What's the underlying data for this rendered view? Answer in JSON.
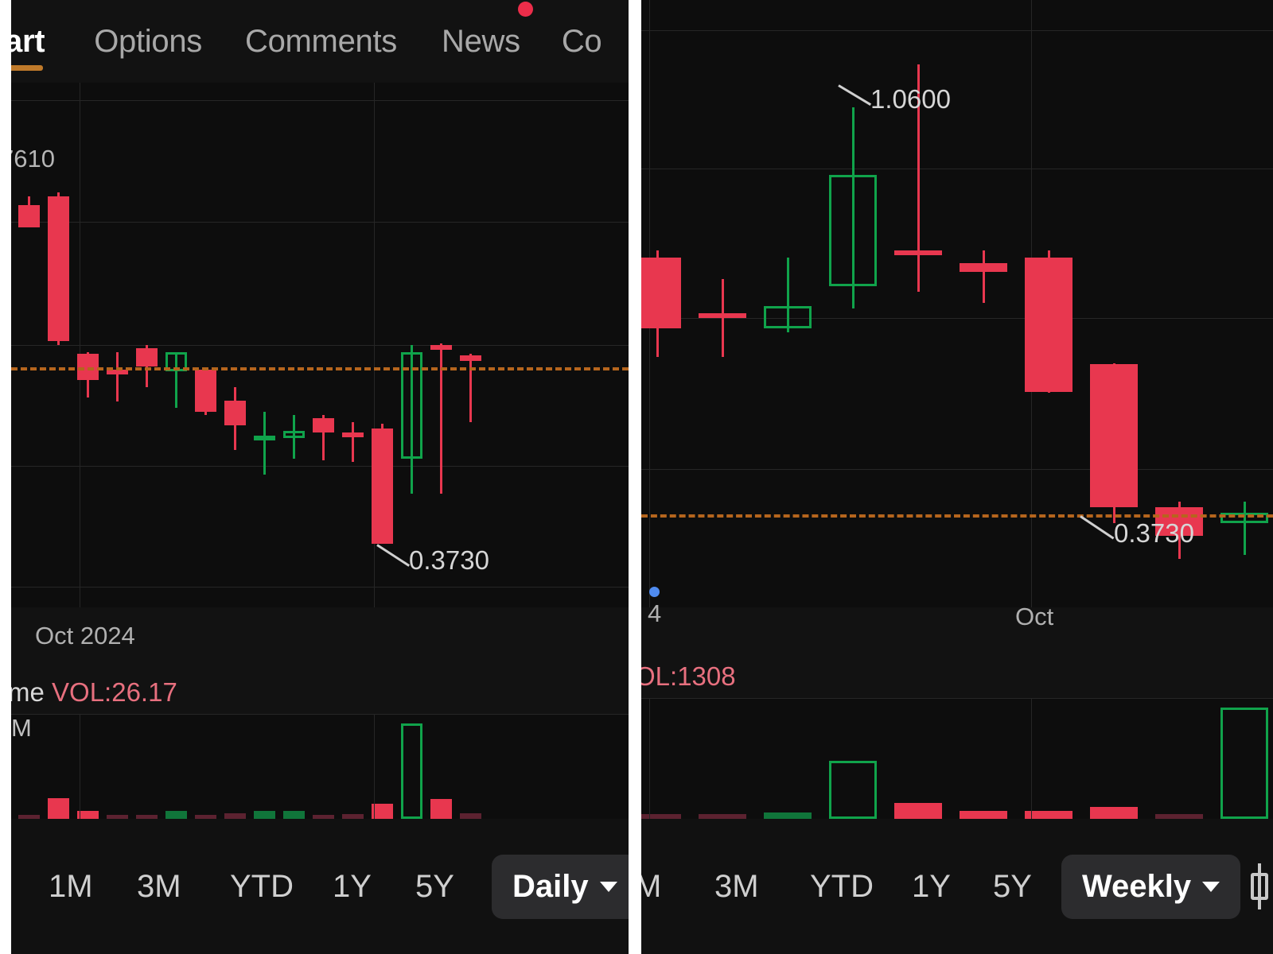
{
  "tabs": [
    {
      "id": "chart",
      "label": "art",
      "active": true,
      "badge": false
    },
    {
      "id": "options",
      "label": "Options",
      "active": false,
      "badge": false
    },
    {
      "id": "comments",
      "label": "Comments",
      "active": false,
      "badge": false
    },
    {
      "id": "news",
      "label": "News",
      "active": false,
      "badge": true
    },
    {
      "id": "co",
      "label": "Co",
      "active": false,
      "badge": false
    }
  ],
  "colors": {
    "background": "#121212",
    "plot_background": "#0d0d0d",
    "up": "#10a34b",
    "down": "#e8374f",
    "price_line": "#b5651d",
    "accent_tab": "#c07a2a",
    "badge": "#ec2d4a",
    "grid": "#262626"
  },
  "left_panel": {
    "y_axis_label": "7610",
    "x_axis_label": "Oct 2024",
    "annotation_low": "0.3730",
    "volume_label_word": "me",
    "volume_label_value": "VOL:26.17",
    "volume_y_label": "M",
    "toolbar": {
      "ranges": [
        "1M",
        "3M",
        "YTD",
        "1Y",
        "5Y"
      ],
      "interval": "Daily"
    }
  },
  "right_panel": {
    "annotation_high": "1.0600",
    "annotation_low": "0.3730",
    "x_axis_label": "Oct",
    "x_axis_partial": "4",
    "volume_label_value": "OL:1308",
    "toolbar": {
      "ranges": [
        "M",
        "3M",
        "YTD",
        "1Y",
        "5Y"
      ],
      "interval": "Weekly",
      "chart_type_icon": "candlestick-icon"
    }
  },
  "chart_data": [
    {
      "type": "candlestick",
      "title": "Daily candlestick chart",
      "interval": "Daily",
      "xlabel": "Oct 2024",
      "ylabel": "",
      "y_tick_labels": [
        "7610"
      ],
      "price_line_value": 0.575,
      "annotations": [
        {
          "text": "0.3730",
          "attach": "low-of-down-candle"
        }
      ],
      "ylim": [
        0.3,
        0.9
      ],
      "grid": true,
      "candles": [
        {
          "o": 0.76,
          "h": 0.77,
          "l": 0.735,
          "c": 0.735,
          "dir": "down"
        },
        {
          "o": 0.77,
          "h": 0.775,
          "l": 0.6,
          "c": 0.605,
          "dir": "down"
        },
        {
          "o": 0.59,
          "h": 0.592,
          "l": 0.54,
          "c": 0.56,
          "dir": "down"
        },
        {
          "o": 0.572,
          "h": 0.592,
          "l": 0.535,
          "c": 0.568,
          "dir": "down"
        },
        {
          "o": 0.596,
          "h": 0.6,
          "l": 0.552,
          "c": 0.575,
          "dir": "down"
        },
        {
          "o": 0.57,
          "h": 0.592,
          "l": 0.528,
          "c": 0.592,
          "dir": "up"
        },
        {
          "o": 0.572,
          "h": 0.575,
          "l": 0.52,
          "c": 0.524,
          "dir": "down"
        },
        {
          "o": 0.536,
          "h": 0.552,
          "l": 0.48,
          "c": 0.508,
          "dir": "down"
        },
        {
          "o": 0.492,
          "h": 0.524,
          "l": 0.452,
          "c": 0.496,
          "dir": "up"
        },
        {
          "o": 0.494,
          "h": 0.52,
          "l": 0.47,
          "c": 0.502,
          "dir": "up"
        },
        {
          "o": 0.516,
          "h": 0.52,
          "l": 0.468,
          "c": 0.5,
          "dir": "down"
        },
        {
          "o": 0.5,
          "h": 0.512,
          "l": 0.466,
          "c": 0.498,
          "dir": "down"
        },
        {
          "o": 0.505,
          "h": 0.51,
          "l": 0.373,
          "c": 0.373,
          "dir": "down"
        },
        {
          "o": 0.47,
          "h": 0.6,
          "l": 0.43,
          "c": 0.592,
          "dir": "up"
        },
        {
          "o": 0.6,
          "h": 0.602,
          "l": 0.43,
          "c": 0.596,
          "dir": "down"
        },
        {
          "o": 0.588,
          "h": 0.59,
          "l": 0.512,
          "c": 0.582,
          "dir": "down"
        }
      ],
      "volume": {
        "label": "VOL:26.17",
        "y_label": "M",
        "bars": [
          {
            "v": 0.04,
            "dir": "flat"
          },
          {
            "v": 0.22,
            "dir": "down"
          },
          {
            "v": 0.08,
            "dir": "down"
          },
          {
            "v": 0.03,
            "dir": "flat"
          },
          {
            "v": 0.03,
            "dir": "flat"
          },
          {
            "v": 0.08,
            "dir": "flatg"
          },
          {
            "v": 0.03,
            "dir": "flat"
          },
          {
            "v": 0.06,
            "dir": "flat"
          },
          {
            "v": 0.08,
            "dir": "flatg"
          },
          {
            "v": 0.08,
            "dir": "flatg"
          },
          {
            "v": 0.03,
            "dir": "flat"
          },
          {
            "v": 0.05,
            "dir": "flat"
          },
          {
            "v": 0.16,
            "dir": "down"
          },
          {
            "v": 1.0,
            "dir": "up"
          },
          {
            "v": 0.21,
            "dir": "down"
          },
          {
            "v": 0.06,
            "dir": "flat"
          }
        ]
      }
    },
    {
      "type": "candlestick",
      "title": "Weekly candlestick chart",
      "interval": "Weekly",
      "xlabel": "Oct",
      "ylabel": "",
      "y_tick_labels": [],
      "price_line_value": 0.43,
      "annotations": [
        {
          "text": "1.0600",
          "attach": "high-of-down-candle"
        },
        {
          "text": "0.3730",
          "attach": "low-of-up-candle"
        }
      ],
      "ylim": [
        0.3,
        1.15
      ],
      "grid": true,
      "candles": [
        {
          "o": 0.79,
          "h": 0.8,
          "l": 0.65,
          "c": 0.69,
          "dir": "down"
        },
        {
          "o": 0.712,
          "h": 0.76,
          "l": 0.65,
          "c": 0.712,
          "dir": "down"
        },
        {
          "o": 0.69,
          "h": 0.79,
          "l": 0.685,
          "c": 0.722,
          "dir": "up"
        },
        {
          "o": 0.75,
          "h": 1.0,
          "l": 0.718,
          "c": 0.905,
          "dir": "up"
        },
        {
          "o": 0.8,
          "h": 1.06,
          "l": 0.742,
          "c": 0.796,
          "dir": "down"
        },
        {
          "o": 0.782,
          "h": 0.8,
          "l": 0.726,
          "c": 0.77,
          "dir": "down"
        },
        {
          "o": 0.79,
          "h": 0.8,
          "l": 0.6,
          "c": 0.602,
          "dir": "down"
        },
        {
          "o": 0.64,
          "h": 0.642,
          "l": 0.418,
          "c": 0.44,
          "dir": "down"
        },
        {
          "o": 0.44,
          "h": 0.448,
          "l": 0.368,
          "c": 0.4,
          "dir": "down"
        },
        {
          "o": 0.418,
          "h": 0.448,
          "l": 0.373,
          "c": 0.432,
          "dir": "up"
        }
      ],
      "volume": {
        "label": "OL:1308",
        "bars": [
          {
            "v": 0.04,
            "dir": "flat"
          },
          {
            "v": 0.04,
            "dir": "flat"
          },
          {
            "v": 0.06,
            "dir": "flatg"
          },
          {
            "v": 0.52,
            "dir": "up"
          },
          {
            "v": 0.14,
            "dir": "down"
          },
          {
            "v": 0.07,
            "dir": "down"
          },
          {
            "v": 0.07,
            "dir": "down"
          },
          {
            "v": 0.11,
            "dir": "down"
          },
          {
            "v": 0.04,
            "dir": "flat"
          },
          {
            "v": 1.0,
            "dir": "up"
          }
        ]
      }
    }
  ]
}
